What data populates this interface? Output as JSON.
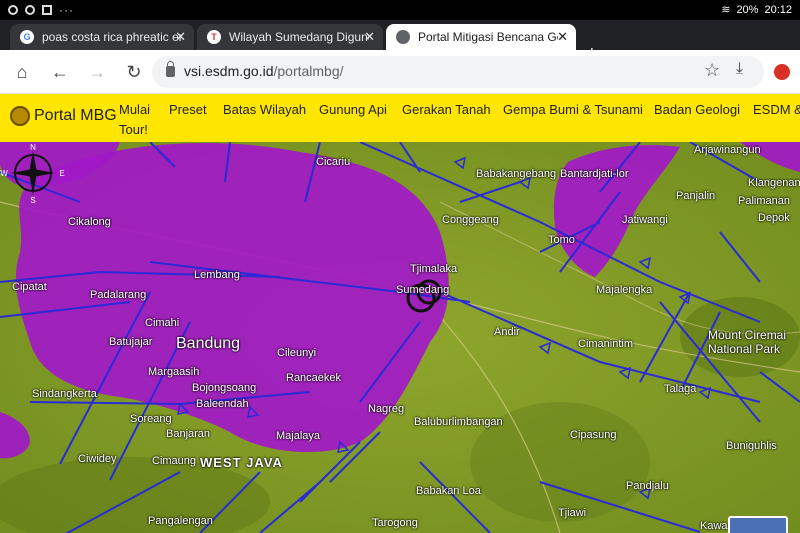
{
  "status": {
    "battery": "20%",
    "time": "20:12"
  },
  "tabs": [
    {
      "title": "poas costa rica phreatic eru",
      "favicon": "G"
    },
    {
      "title": "Wilayah Sumedang Diguncang",
      "favicon": "T"
    },
    {
      "title": "Portal Mitigasi Bencana Geo",
      "favicon": "globe"
    }
  ],
  "address": {
    "domain": "vsi.esdm.go.id",
    "path": "/portalmbg/"
  },
  "site": {
    "brand": "Portal MBG",
    "nav": [
      "Mulai Tour!",
      "Preset",
      "Batas Wilayah",
      "Gunung Api",
      "Gerakan Tanah",
      "Gempa Bumi & Tsunami",
      "Badan Geologi",
      "ESDM &"
    ]
  },
  "map": {
    "labels": [
      "Cicariu",
      "Babakangebang",
      "Bantardjati-lor",
      "Arjawinangun",
      "Klangenan",
      "Cikalong",
      "Panjalin",
      "Palimanan",
      "Conggeang",
      "Jatiwangi",
      "Depok",
      "Tomo",
      "Tjimalaka",
      "Lembang",
      "Cipatat",
      "Padalarang",
      "Sumedang",
      "Majalengka",
      "Cimahi",
      "Andir",
      "Batujajar",
      "Bandung",
      "Cileunyi",
      "Cimanintim",
      "Mount Ciremai National Park",
      "Margaasih",
      "Rancaekek",
      "Bojongsoang",
      "Sindangkerta",
      "Nagreg",
      "Talaga",
      "Soreang",
      "Baleendah",
      "Baluburlimbangan",
      "Banjaran",
      "Majalaya",
      "Cipasung",
      "Buniguhlis",
      "Ciwidey",
      "Cimaung",
      "WEST JAVA",
      "Pandjalu",
      "Babakan Loa",
      "Tjiawi",
      "Pangalengan",
      "Tarogong",
      "Kawa"
    ],
    "compass": {
      "n": "N",
      "s": "S",
      "e": "E",
      "w": "W"
    }
  }
}
